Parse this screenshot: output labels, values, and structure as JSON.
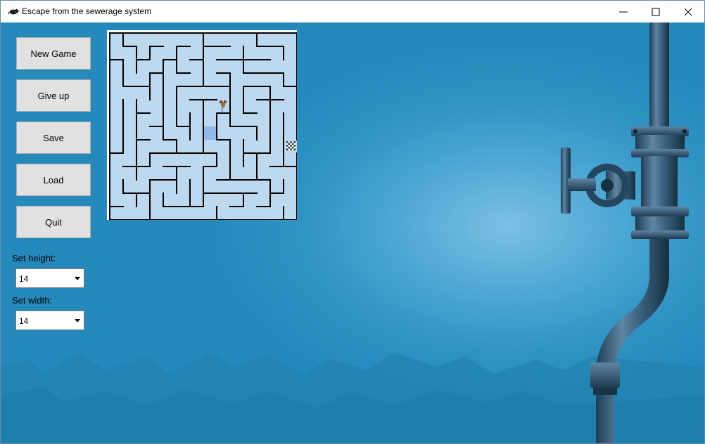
{
  "window": {
    "title": "Escape from the sewerage system",
    "icon": "rat-icon",
    "controls": [
      "minimize-icon",
      "maximize-icon",
      "close-icon"
    ]
  },
  "sidebar": {
    "buttons": [
      {
        "label": "New Game"
      },
      {
        "label": "Give up"
      },
      {
        "label": "Save"
      },
      {
        "label": "Load"
      },
      {
        "label": "Quit"
      }
    ],
    "height_label": "Set height:",
    "height_value": "14",
    "width_label": "Set width:",
    "width_value": "14"
  },
  "maze": {
    "rows": 14,
    "cols": 14,
    "cell_color": "#bcd9ef",
    "wall_color": "#000000",
    "player": "mouse-icon",
    "goal": "checkered-exit-icon",
    "highlight_color": "#8fb8e6"
  },
  "background": {
    "theme": "sewer-blue",
    "decoration": "pipe-valve-illustration"
  }
}
